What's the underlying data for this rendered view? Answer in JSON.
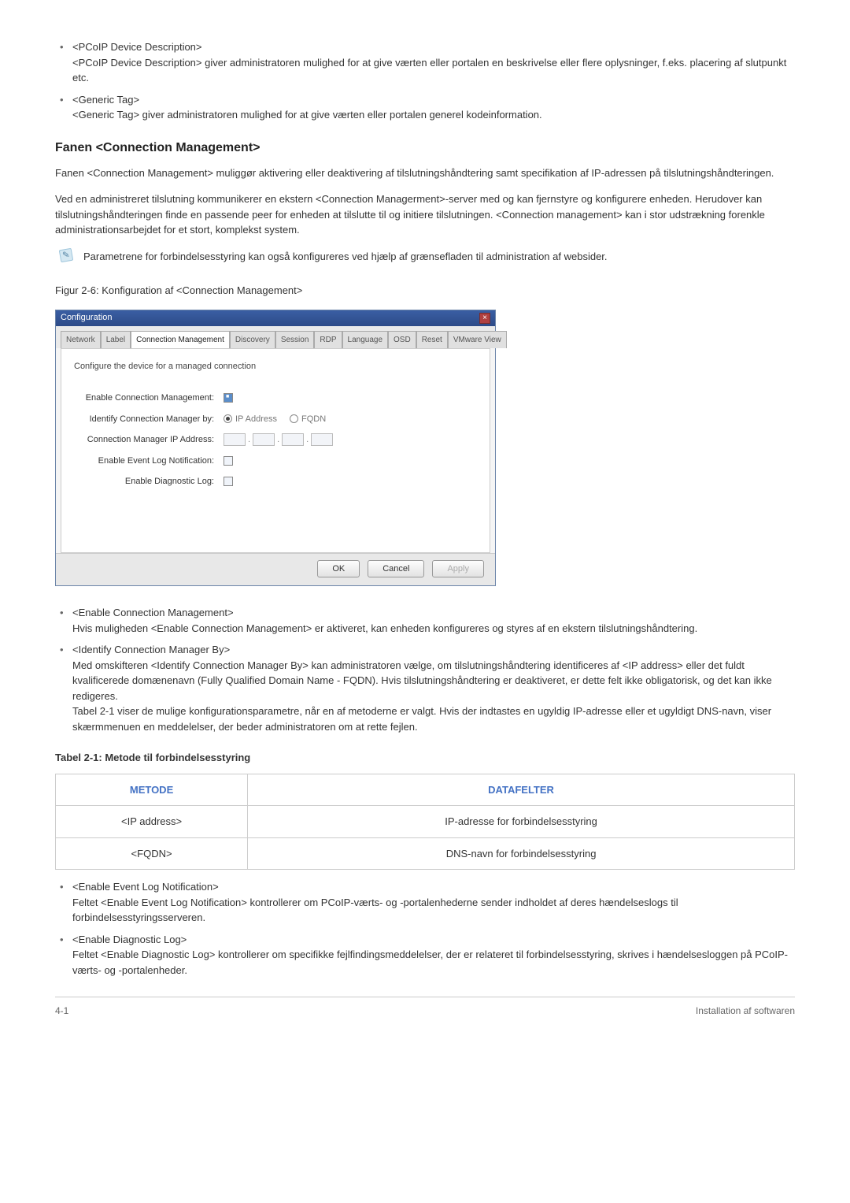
{
  "top_list": [
    {
      "title": "<PCoIP Device Description>",
      "desc": "<PCoIP Device Description> giver administratoren mulighed for at give værten eller portalen en beskrivelse eller flere oplysninger, f.eks. placering af slutpunkt etc."
    },
    {
      "title": "<Generic Tag>",
      "desc": "<Generic Tag> giver administratoren mulighed for at give værten eller portalen generel kodeinformation."
    }
  ],
  "section": {
    "heading": "Fanen <Connection Management>",
    "p1": "Fanen <Connection Management> muliggør aktivering eller deaktivering af tilslutningshåndtering samt specifikation af IP-adressen på tilslutningshåndteringen.",
    "p2": "Ved en administreret tilslutning kommunikerer en ekstern <Connection Managerment>-server med og kan fjernstyre og konfigurere enheden. Herudover kan tilslutningshåndteringen finde en passende peer for enheden at tilslutte til og initiere tilslutningen. <Connection management> kan i stor udstrækning forenkle administrationsarbejdet for et stort, komplekst system.",
    "note": "Parametrene for forbindelsesstyring kan også konfigureres ved hjælp af grænsefladen til administration af websider.",
    "figure_caption": "Figur 2-6: Konfiguration af <Connection Management>"
  },
  "cfg_window": {
    "title": "Configuration",
    "tabs": [
      "Network",
      "Label",
      "Connection Management",
      "Discovery",
      "Session",
      "RDP",
      "Language",
      "OSD",
      "Reset",
      "VMware View"
    ],
    "active_tab_index": 2,
    "body_desc": "Configure the device for a managed connection",
    "rows": {
      "enable_cm": "Enable Connection Management:",
      "identify": "Identify Connection Manager by:",
      "cm_ip": "Connection Manager IP Address:",
      "event_log": "Enable Event Log Notification:",
      "diag_log": "Enable Diagnostic Log:",
      "radio_ip": "IP Address",
      "radio_fqdn": "FQDN"
    },
    "buttons": {
      "ok": "OK",
      "cancel": "Cancel",
      "apply": "Apply"
    }
  },
  "mid_list": [
    {
      "title": "<Enable Connection Management>",
      "desc": "Hvis muligheden <Enable Connection Management> er aktiveret, kan enheden konfigureres og styres af en ekstern tilslutningshåndtering."
    },
    {
      "title": "<Identify Connection Manager By>",
      "desc": "Med omskifteren <Identify Connection Manager By> kan administratoren vælge, om tilslutningshåndtering identificeres af <IP address> eller det fuldt kvalificerede domænenavn (Fully Qualified Domain Name - FQDN). Hvis tilslutningshåndtering er deaktiveret, er dette felt ikke obligatorisk, og det kan ikke redigeres.",
      "desc2": "Tabel 2-1 viser de mulige konfigurationsparametre, når en af metoderne er valgt. Hvis der indtastes en ugyldig IP-adresse eller et ugyldigt DNS-navn, viser skærmmenuen en meddelelser, der beder administratoren om at rette fejlen."
    }
  ],
  "table": {
    "title": "Tabel 2-1: Metode til forbindelsesstyring",
    "headers": [
      "METODE",
      "DATAFELTER"
    ],
    "rows": [
      [
        "<IP address>",
        "IP-adresse for forbindelsesstyring"
      ],
      [
        "<FQDN>",
        "DNS-navn for forbindelsesstyring"
      ]
    ]
  },
  "bottom_list": [
    {
      "title": "<Enable Event Log Notification>",
      "desc": "Feltet <Enable Event Log Notification> kontrollerer om PCoIP-værts- og -portalenhederne sender indholdet af deres hændelseslogs til forbindelsesstyringsserveren."
    },
    {
      "title": "<Enable Diagnostic Log>",
      "desc": "Feltet <Enable Diagnostic Log> kontrollerer om specifikke fejlfindingsmeddelelser, der er relateret til forbindelsesstyring, skrives i hændelsesloggen på PCoIP-værts- og -portalenheder."
    }
  ],
  "footer": {
    "left": "4-1",
    "right": "Installation af softwaren"
  }
}
